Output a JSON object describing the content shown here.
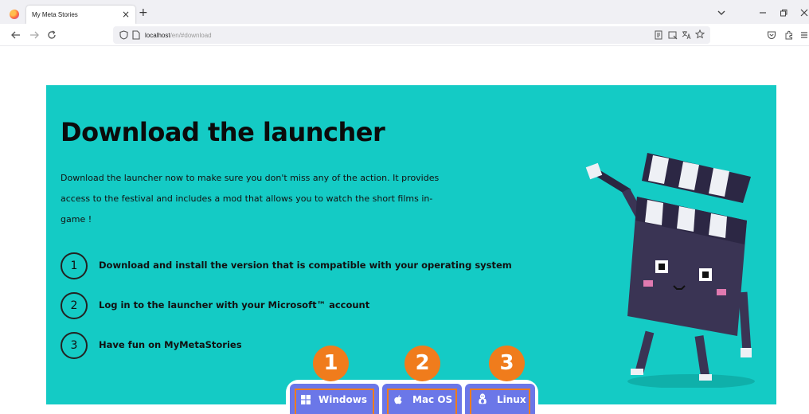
{
  "browser": {
    "tab_title": "My Meta Stories",
    "tab_close": "×",
    "new_tab": "+",
    "url_host": "localhost",
    "url_path": "/en/#download"
  },
  "hero": {
    "title": "Download the launcher",
    "description": "Download the launcher now to make sure you don't miss any of the action. It provides access to the festival and includes a mod that allows you to watch the short films in-game !",
    "background_color": "#14cbc5",
    "steps": [
      {
        "number": "1",
        "text": "Download and install the version that is compatible with your operating system"
      },
      {
        "number": "2",
        "text": "Log in to the launcher with your Microsoft™ account"
      },
      {
        "number": "3",
        "text": "Have fun on MyMetaStories"
      }
    ]
  },
  "downloads": {
    "button_color": "#6b77e8",
    "highlight_color": "#f07c1c",
    "buttons": [
      {
        "label": "Windows",
        "icon": "windows-icon",
        "badge": "1"
      },
      {
        "label": "Mac OS",
        "icon": "apple-icon",
        "badge": "2"
      },
      {
        "label": "Linux",
        "icon": "linux-icon",
        "badge": "3"
      }
    ]
  }
}
